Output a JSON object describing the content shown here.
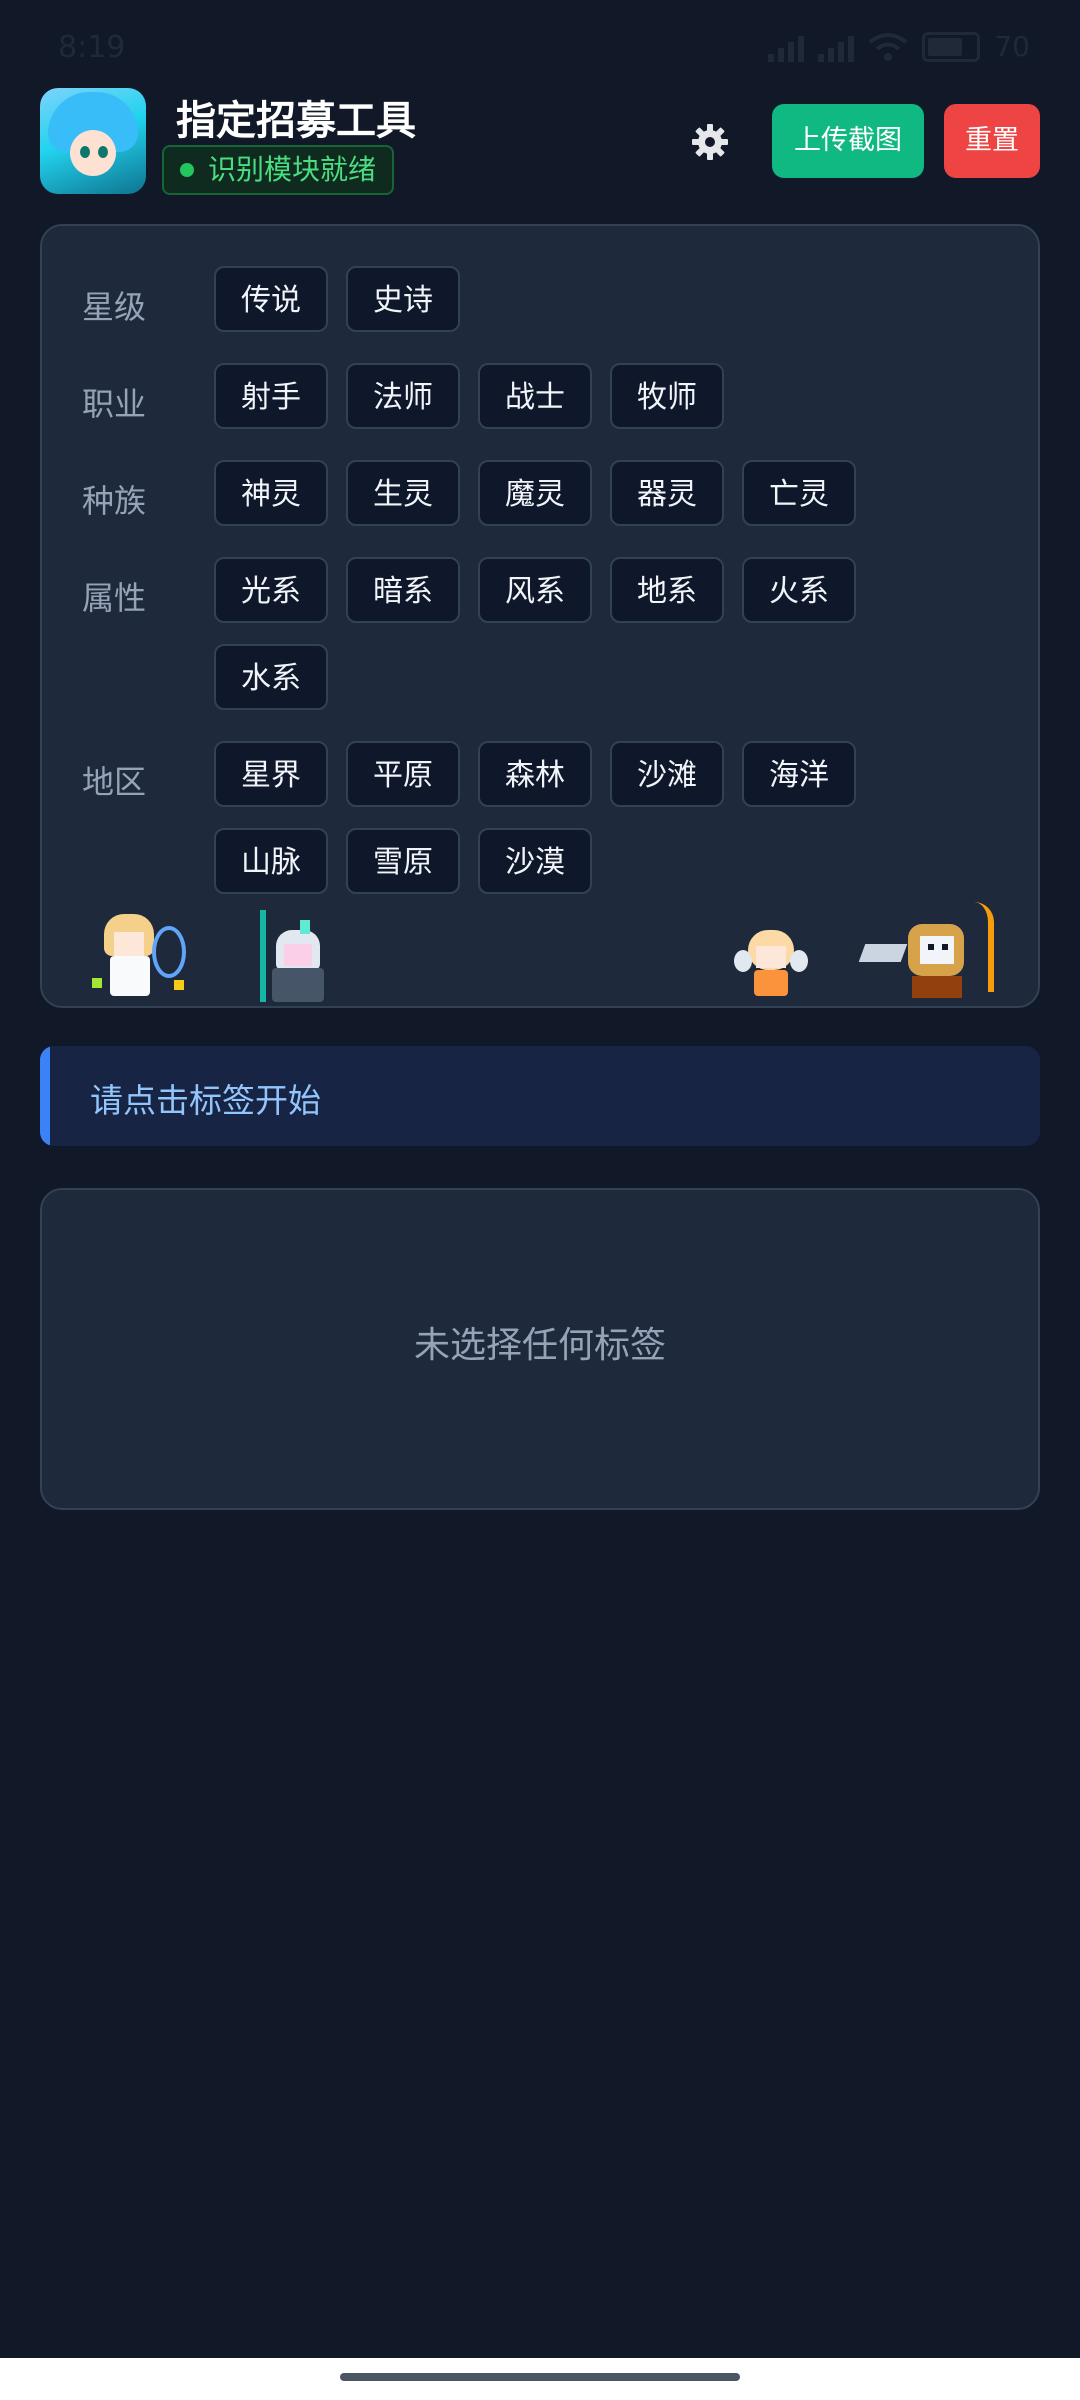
{
  "status_bar": {
    "time": "8:19",
    "battery": "70"
  },
  "header": {
    "title": "指定招募工具",
    "status": "识别模块就绪",
    "upload_label": "上传截图",
    "reset_label": "重置",
    "icons": {
      "settings": "gear-icon",
      "avatar": "app-avatar"
    }
  },
  "categories": [
    {
      "label": "星级",
      "tags": [
        "传说",
        "史诗"
      ]
    },
    {
      "label": "职业",
      "tags": [
        "射手",
        "法师",
        "战士",
        "牧师"
      ]
    },
    {
      "label": "种族",
      "tags": [
        "神灵",
        "生灵",
        "魔灵",
        "器灵",
        "亡灵"
      ]
    },
    {
      "label": "属性",
      "tags": [
        "光系",
        "暗系",
        "风系",
        "地系",
        "火系",
        "水系"
      ]
    },
    {
      "label": "地区",
      "tags": [
        "星界",
        "平原",
        "森林",
        "沙滩",
        "海洋",
        "山脉",
        "雪原",
        "沙漠"
      ]
    }
  ],
  "hint": {
    "text": "请点击标签开始"
  },
  "selection": {
    "empty_text": "未选择任何标签"
  },
  "colors": {
    "background": "#111827",
    "panel": "#1e293b",
    "upload_button": "#10b981",
    "reset_button": "#ef4444",
    "ready_status": "#4ade80",
    "hint_accent": "#3b82f6"
  }
}
